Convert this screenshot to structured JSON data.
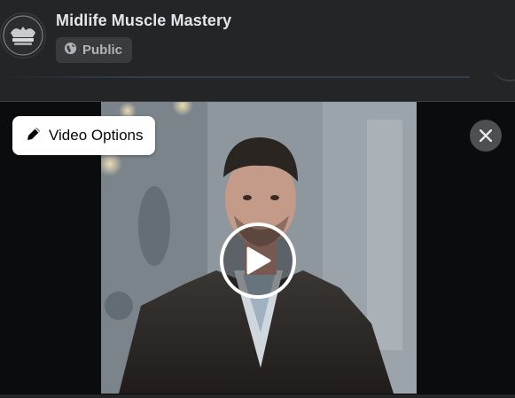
{
  "post": {
    "page_name": "Midlife Muscle Mastery",
    "avatar_text": "MIDLIFE MUSCLE MASTERY",
    "privacy_label": "Public",
    "privacy_icon": "globe-icon"
  },
  "viewer": {
    "video_options_label": "Video Options",
    "video_options_icon": "pencil-icon",
    "close_icon": "close-icon",
    "play_icon": "play-icon"
  },
  "colors": {
    "background": "#242526",
    "text_primary": "#e4e6eb",
    "text_secondary": "#b0b3b8",
    "badge_bg": "#3a3b3c",
    "viewer_bg": "#0b0c0e"
  }
}
